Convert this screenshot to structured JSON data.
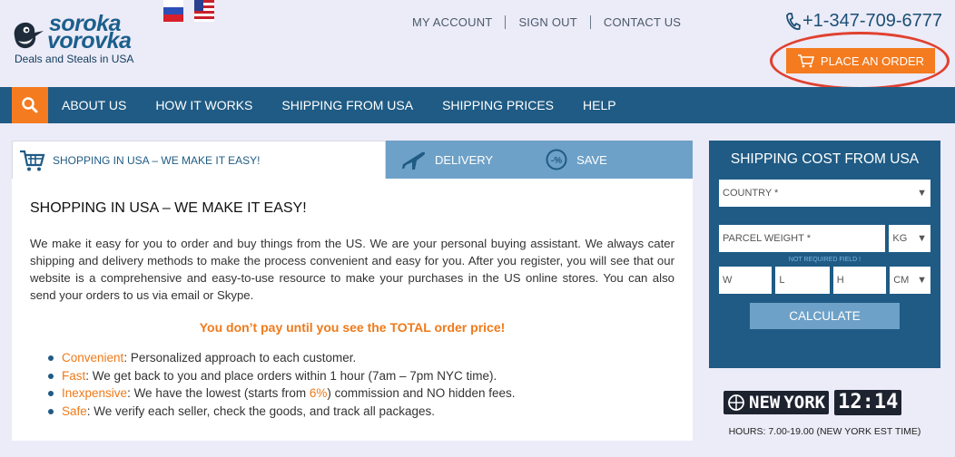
{
  "header": {
    "logo": {
      "line1": "soroka",
      "line2": "vorovka",
      "tagline": "Deals and Steals in USA"
    },
    "languages": [
      {
        "icon": "russian-flag-icon"
      },
      {
        "icon": "usa-flag-icon"
      }
    ],
    "links": [
      "MY ACCOUNT",
      "SIGN OUT",
      "CONTACT US"
    ],
    "phone": "+1-347-709-6777",
    "order_button": "PLACE AN ORDER",
    "colors": {
      "accent": "#f47b1f",
      "brand": "#1f5b84",
      "highlight_circle": "#e0412f"
    }
  },
  "nav": {
    "search_icon": "search-icon",
    "items": [
      "ABOUT US",
      "HOW IT WORKS",
      "SHIPPING FROM USA",
      "SHIPPING PRICES",
      "HELP"
    ]
  },
  "main": {
    "tabs": {
      "active": "SHOPPING IN USA – WE MAKE IT EASY!",
      "delivery": "DELIVERY",
      "save": "SAVE",
      "save_badge": "-%"
    },
    "heading": "SHOPPING IN USA – WE MAKE IT EASY!",
    "intro": "We make it easy for you to order and buy things from the US. We are your personal buying assistant. We always cater shipping and delivery methods to make the process convenient and easy for you. After you register, you will see that our website is a comprehensive and easy-to-use resource to make your purchases in the US online stores. You can also send your orders to us via email or Skype.",
    "highlight": "You don’t pay until you see the TOTAL order price!",
    "benefits": [
      {
        "key": "Convenient",
        "text": ": Personalized approach to each customer."
      },
      {
        "key": "Fast",
        "text": ": We get back to you and place orders within 1 hour (7am – 7pm NYC time)."
      },
      {
        "key": "Inexpensive",
        "text_pre": ": We have the lowest (starts from ",
        "percent": "6%",
        "text_post": ") commission and NO hidden fees."
      },
      {
        "key": "Safe",
        "text": ": We verify each seller, check the goods, and track all packages."
      }
    ]
  },
  "calculator": {
    "title": "SHIPPING COST FROM USA",
    "country_placeholder": "COUNTRY *",
    "weight_placeholder": "PARCEL WEIGHT *",
    "weight_unit": "KG",
    "note": "NOT REQUIRED FIELD !",
    "w": "W",
    "l": "L",
    "h": "H",
    "dim_unit": "CM",
    "button": "CALCULATE"
  },
  "clock": {
    "city_n": "NEW",
    "city_y": "YORK",
    "hour": "12",
    "minute": "14",
    "hours_text": "HOURS: 7.00-19.00 (NEW YORK EST TIME)"
  }
}
